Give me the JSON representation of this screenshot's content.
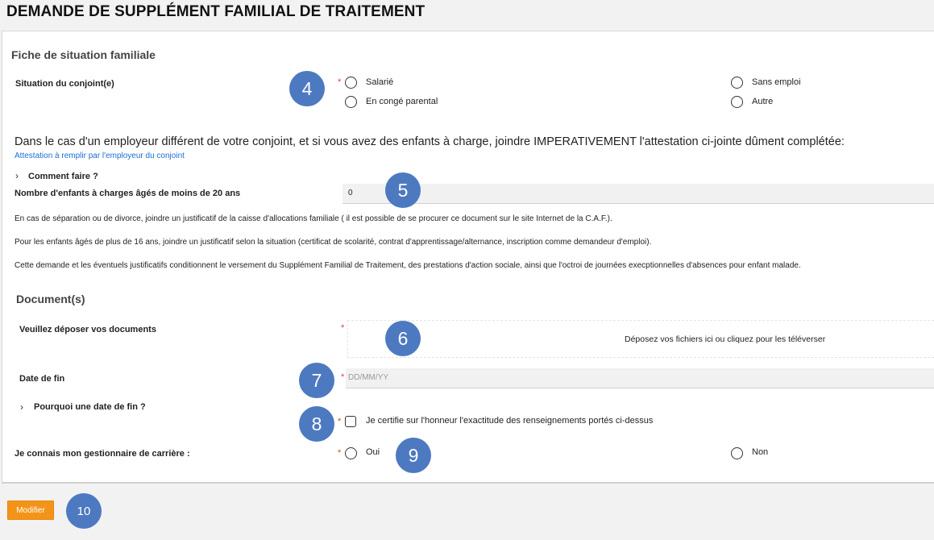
{
  "page": {
    "title": "DEMANDE DE SUPPLÉMENT FAMILIAL DE TRAITEMENT"
  },
  "family": {
    "section_title": "Fiche de situation familiale",
    "spouse_label": "Situation du conjoint(e)",
    "required_mark": "*",
    "options": [
      "Salarié",
      "En congé parental",
      "Sans emploi",
      "Autre"
    ]
  },
  "notice": {
    "main_text": "Dans le cas d'un employeur différent de votre conjoint, et si vous avez des enfants à charge, joindre IMPERATIVEMENT l'attestation ci-jointe dûment complétée:",
    "link_text": "Attestation à remplir par l'employeur du conjoint"
  },
  "howto": {
    "label": "Comment faire ?"
  },
  "children": {
    "label": "Nombre d'enfants à charges âgés de moins de 20 ans",
    "value": "0"
  },
  "info": [
    "En cas de séparation ou de divorce, joindre un justificatif de la caisse d'allocations familiale ( il est possible de se procurer ce document sur le site Internet de la C.A.F.).",
    "Pour les enfants âgés de plus de 16 ans, joindre un justificatif selon la situation (certificat de scolarité, contrat d'apprentissage/alternance, inscription comme demandeur d'emploi).",
    "Cette demande et les éventuels justificatifs conditionnent le versement du Supplément Familial de Traitement, des prestations d'action sociale, ainsi que l'octroi de journées execptionnelles d'absences pour enfant malade."
  ],
  "documents": {
    "section_title": "Document(s)",
    "upload_label": "Veuillez déposer vos documents",
    "dropzone_text": "Déposez vos fichiers ici ou cliquez pour les téléverser",
    "end_date_label": "Date de fin",
    "end_date_placeholder": "DD/MM/YY",
    "why_end_date": "Pourquoi une date de fin ?",
    "certify_text": "Je certifie sur l'honneur l'exactitude des renseignements portés ci-dessus"
  },
  "manager": {
    "label": "Je connais mon gestionnaire de carrière :",
    "options": [
      "Oui",
      "Non"
    ]
  },
  "actions": {
    "modify_label": "Modifier"
  },
  "markers": [
    "4",
    "5",
    "6",
    "7",
    "8",
    "9",
    "10"
  ],
  "colors": {
    "marker": "#4d79c0",
    "button": "#f39418",
    "required": "#e53935",
    "link": "#1a6fd1"
  }
}
